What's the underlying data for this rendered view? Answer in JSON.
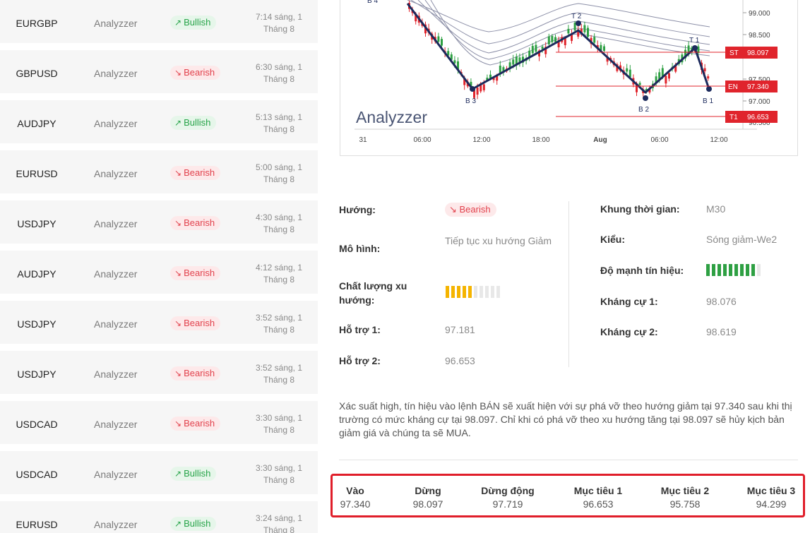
{
  "signals": [
    {
      "pair": "EURGBP",
      "source": "Analyzzer",
      "trend": "Bullish",
      "time_line1": "7:14 sáng, 1",
      "time_line2": "Tháng 8"
    },
    {
      "pair": "GBPUSD",
      "source": "Analyzzer",
      "trend": "Bearish",
      "time_line1": "6:30 sáng, 1",
      "time_line2": "Tháng 8"
    },
    {
      "pair": "AUDJPY",
      "source": "Analyzzer",
      "trend": "Bullish",
      "time_line1": "5:13 sáng, 1",
      "time_line2": "Tháng 8"
    },
    {
      "pair": "EURUSD",
      "source": "Analyzzer",
      "trend": "Bearish",
      "time_line1": "5:00 sáng, 1",
      "time_line2": "Tháng 8"
    },
    {
      "pair": "USDJPY",
      "source": "Analyzzer",
      "trend": "Bearish",
      "time_line1": "4:30 sáng, 1",
      "time_line2": "Tháng 8"
    },
    {
      "pair": "AUDJPY",
      "source": "Analyzzer",
      "trend": "Bearish",
      "time_line1": "4:12 sáng, 1",
      "time_line2": "Tháng 8"
    },
    {
      "pair": "USDJPY",
      "source": "Analyzzer",
      "trend": "Bearish",
      "time_line1": "3:52 sáng, 1",
      "time_line2": "Tháng 8"
    },
    {
      "pair": "USDJPY",
      "source": "Analyzzer",
      "trend": "Bearish",
      "time_line1": "3:52 sáng, 1",
      "time_line2": "Tháng 8"
    },
    {
      "pair": "USDCAD",
      "source": "Analyzzer",
      "trend": "Bearish",
      "time_line1": "3:30 sáng, 1",
      "time_line2": "Tháng 8"
    },
    {
      "pair": "USDCAD",
      "source": "Analyzzer",
      "trend": "Bullish",
      "time_line1": "3:30 sáng, 1",
      "time_line2": "Tháng 8"
    },
    {
      "pair": "EURUSD",
      "source": "Analyzzer",
      "trend": "Bullish",
      "time_line1": "3:24 sáng, 1",
      "time_line2": "Tháng 8"
    }
  ],
  "chart": {
    "watermark": "Analyzzer",
    "x_ticks": [
      "31",
      "06:00",
      "12:00",
      "18:00",
      "Aug",
      "06:00",
      "12:00"
    ],
    "y_ticks": [
      "99.000",
      "98.500",
      "97.500",
      "97.000",
      "96.500"
    ],
    "pivots": [
      "B 4",
      "B 3",
      "T 2",
      "B 2",
      "T 1",
      "B 1"
    ],
    "price_tags": [
      {
        "label": "ST",
        "value": "98.097"
      },
      {
        "label": "EN",
        "value": "97.340"
      },
      {
        "label": "T1",
        "value": "96.653"
      }
    ],
    "colors": {
      "zigzag": "#1c2a5c",
      "bull_candle": "#2ea043",
      "bear_candle": "#e0242c",
      "level_line": "#e0242c",
      "ema": "#8d90a8"
    }
  },
  "details": {
    "direction_label": "Hướng:",
    "direction_value": "Bearish",
    "pattern_label": "Mô hình:",
    "pattern_value": "Tiếp tục xu hướng Giảm",
    "quality_label": "Chất lượng xu hướng:",
    "quality_level": 0.5,
    "support1_label": "Hỗ trợ 1:",
    "support1_value": "97.181",
    "support2_label": "Hỗ trợ 2:",
    "support2_value": "96.653",
    "timeframe_label": "Khung thời gian:",
    "timeframe_value": "M30",
    "type_label": "Kiểu:",
    "type_value": "Sóng giảm-We2",
    "strength_label": "Độ mạnh tín hiệu:",
    "strength_level": 0.9,
    "resistance1_label": "Kháng cự 1:",
    "resistance1_value": "98.076",
    "resistance2_label": "Kháng cự 2:",
    "resistance2_value": "98.619",
    "colors": {
      "quality_on": "#f5b400",
      "strength_on": "#2ea043",
      "bar_off": "#e8e8e8"
    }
  },
  "summary": "Xác suất high, tín hiệu vào lệnh BÁN sẽ xuất hiện với sự phá vỡ theo hướng giảm tại 97.340 sau khi thị trường có mức kháng cự tại 98.097. Chỉ khi có phá vỡ theo xu hướng tăng tại 98.097 sẽ hủy kịch bản giảm giá và chúng ta sẽ MUA.",
  "levels": [
    {
      "title": "Vào",
      "value": "97.340"
    },
    {
      "title": "Dừng",
      "value": "98.097"
    },
    {
      "title": "Dừng động",
      "value": "97.719"
    },
    {
      "title": "Mục tiêu 1",
      "value": "96.653"
    },
    {
      "title": "Mục tiêu 2",
      "value": "95.758"
    },
    {
      "title": "Mục tiêu 3",
      "value": "94.299"
    }
  ]
}
